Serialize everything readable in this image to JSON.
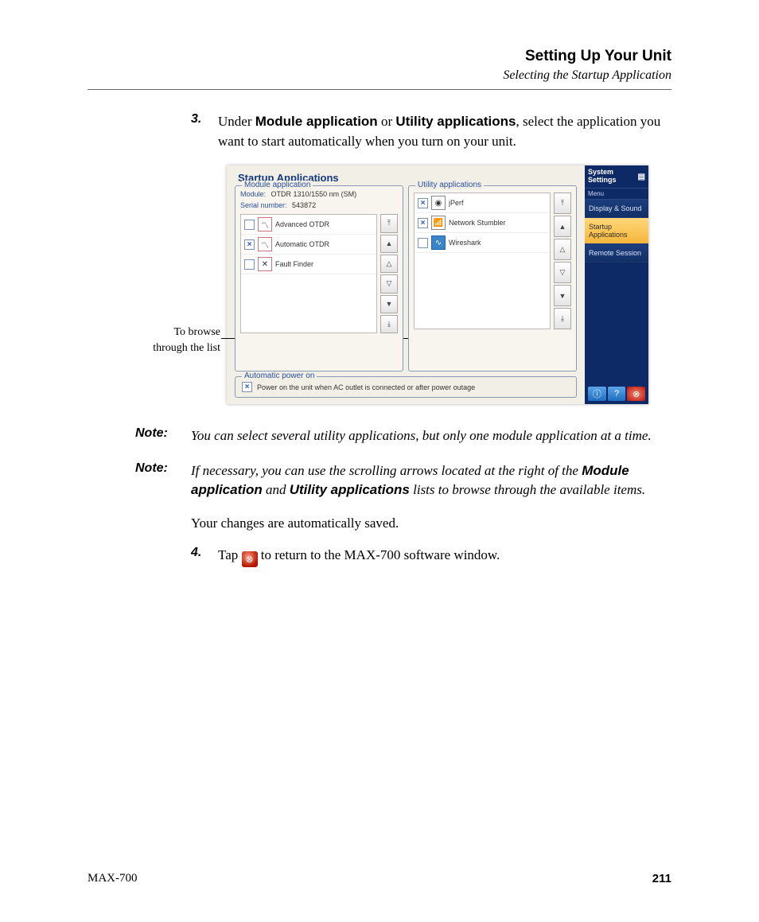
{
  "header": {
    "title": "Setting Up Your Unit",
    "subtitle": "Selecting the Startup Application"
  },
  "step3": {
    "num": "3.",
    "text_before": "Under ",
    "bold1": "Module application",
    "text_mid1": " or ",
    "bold2": "Utility applications",
    "text_after": ", select the application you want to start automatically when you turn on your unit."
  },
  "callout": {
    "line1": "To browse",
    "line2": "through the list"
  },
  "screenshot": {
    "title": "Startup Applications",
    "module_panel": {
      "legend": "Module application",
      "module_label": "Module:",
      "module_value": "OTDR 1310/1550 nm (SM)",
      "serial_label": "Serial number:",
      "serial_value": "543872",
      "apps": [
        {
          "checked": false,
          "name": "Advanced OTDR"
        },
        {
          "checked": true,
          "name": "Automatic OTDR"
        },
        {
          "checked": false,
          "name": "Fault Finder"
        }
      ]
    },
    "utility_panel": {
      "legend": "Utility applications",
      "apps": [
        {
          "checked": true,
          "name": "jPerf"
        },
        {
          "checked": true,
          "name": "Network Stumbler"
        },
        {
          "checked": false,
          "name": "Wireshark"
        }
      ]
    },
    "auto_power": {
      "legend": "Automatic power on",
      "checked": true,
      "label": "Power on the unit when AC outlet is connected or after power outage"
    },
    "scroll_glyphs": {
      "top": "⤒",
      "up": "▲",
      "su": "△",
      "sd": "▽",
      "dn": "▼",
      "bot": "⤓"
    },
    "sidebar": {
      "heading": "System Settings",
      "menu": "Menu",
      "items": [
        {
          "label": "Display & Sound",
          "active": false
        },
        {
          "label": "Startup Applications",
          "active": true
        },
        {
          "label": "Remote Session",
          "active": false
        }
      ],
      "footer_icons": {
        "info": "ⓘ",
        "help": "?",
        "close": "⊗"
      }
    }
  },
  "note1": {
    "label": "Note:",
    "text": "You can select several utility applications, but only one module application at a time."
  },
  "note2": {
    "label": "Note:",
    "t1": "If necessary, you can use the scrolling arrows located at the right of the ",
    "b1": "Module application",
    "t2": " and ",
    "b2": "Utility applications",
    "t3": " lists to browse through the available items."
  },
  "autosave": "Your changes are automatically saved.",
  "step4": {
    "num": "4.",
    "t1": "Tap ",
    "t2": " to return to the MAX-700 software window.",
    "icon_glyph": "⊗"
  },
  "footer": {
    "product": "MAX-700",
    "page": "211"
  }
}
